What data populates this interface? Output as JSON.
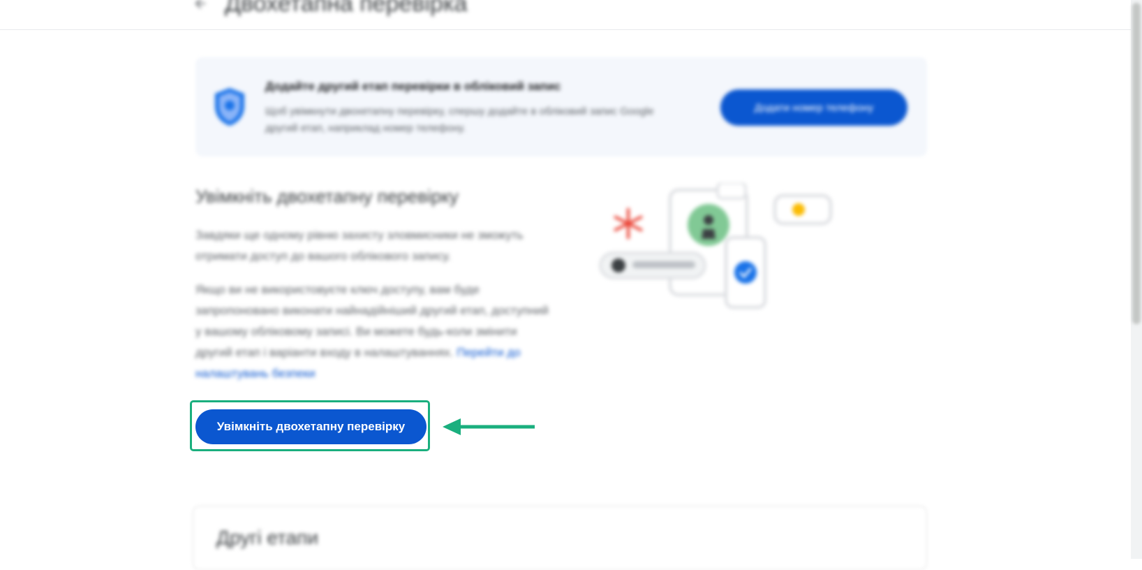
{
  "header": {
    "title": "Двохетапна перевірка"
  },
  "banner": {
    "title": "Додайте другий етап перевірки в обліковий запис",
    "text": "Щоб увімкнути двохетапну перевірку, спершу додайте в обліковий запис Google другий етап, наприклад номер телефону.",
    "button_label": "Додати номер телефону"
  },
  "main": {
    "heading": "Увімкніть двохетапну перевірку",
    "paragraph1": "Завдяки ще одному рівню захисту зловмисники не зможуть отримати доступ до вашого облікового запису.",
    "paragraph2": "Якщо ви не використовуєте ключ доступу, вам буде запропоновано виконати найнадійніший другий етап, доступний у вашому обліковому записі. Ви можете будь-коли змінити другий етап і варіанти входу в налаштуваннях.",
    "settings_link": "Перейти до налаштувань безпеки",
    "enable_button_label": "Увімкніть двохетапну перевірку"
  },
  "other_steps": {
    "heading": "Другі етапи"
  },
  "colors": {
    "accent": "#0b57d0",
    "highlight": "#1aaf7e"
  }
}
